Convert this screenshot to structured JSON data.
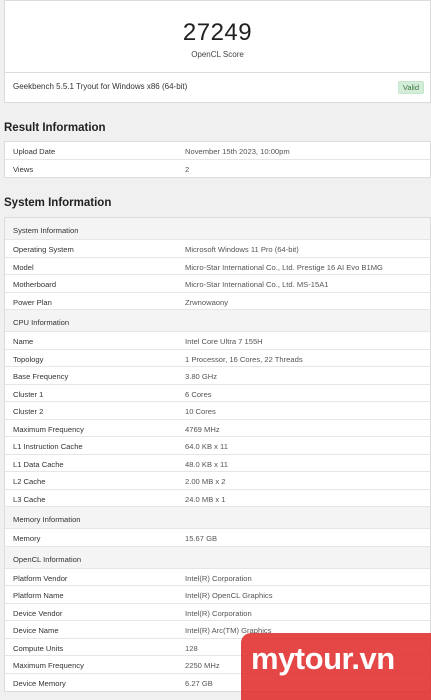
{
  "score": {
    "value": "27249",
    "label": "OpenCL Score"
  },
  "version": {
    "text": "Geekbench 5.5.1 Tryout for Windows x86 (64-bit)",
    "badge": "Valid"
  },
  "result": {
    "title": "Result Information",
    "rows": [
      {
        "key": "Upload Date",
        "value": "November 15th 2023, 10:00pm"
      },
      {
        "key": "Views",
        "value": "2"
      }
    ]
  },
  "system": {
    "title": "System Information",
    "rows": [
      {
        "key": "System Information",
        "value": "",
        "header": true
      },
      {
        "key": "Operating System",
        "value": "Microsoft Windows 11 Pro (64-bit)"
      },
      {
        "key": "Model",
        "value": "Micro-Star International Co., Ltd. Prestige 16 AI Evo B1MG"
      },
      {
        "key": "Motherboard",
        "value": "Micro-Star International Co., Ltd. MS-15A1"
      },
      {
        "key": "Power Plan",
        "value": "Zrwnowaony"
      },
      {
        "key": "CPU Information",
        "value": "",
        "header": true
      },
      {
        "key": "Name",
        "value": "Intel Core Ultra 7 155H"
      },
      {
        "key": "Topology",
        "value": "1 Processor, 16 Cores, 22 Threads"
      },
      {
        "key": "Base Frequency",
        "value": "3.80 GHz"
      },
      {
        "key": "Cluster 1",
        "value": "6 Cores"
      },
      {
        "key": "Cluster 2",
        "value": "10 Cores"
      },
      {
        "key": "Maximum Frequency",
        "value": "4769 MHz"
      },
      {
        "key": "L1 Instruction Cache",
        "value": "64.0 KB x 11"
      },
      {
        "key": "L1 Data Cache",
        "value": "48.0 KB x 11"
      },
      {
        "key": "L2 Cache",
        "value": "2.00 MB x 2"
      },
      {
        "key": "L3 Cache",
        "value": "24.0 MB x 1"
      },
      {
        "key": "Memory Information",
        "value": "",
        "header": true
      },
      {
        "key": "Memory",
        "value": "15.67 GB"
      },
      {
        "key": "OpenCL Information",
        "value": "",
        "header": true
      },
      {
        "key": "Platform Vendor",
        "value": "Intel(R) Corporation"
      },
      {
        "key": "Platform Name",
        "value": "Intel(R) OpenCL Graphics"
      },
      {
        "key": "Device Vendor",
        "value": "Intel(R) Corporation"
      },
      {
        "key": "Device Name",
        "value": "Intel(R) Arc(TM) Graphics"
      },
      {
        "key": "Compute Units",
        "value": "128"
      },
      {
        "key": "Maximum Frequency",
        "value": "2250 MHz"
      },
      {
        "key": "Device Memory",
        "value": "6.27 GB"
      }
    ]
  },
  "watermark": {
    "text": "mytour.vn"
  }
}
